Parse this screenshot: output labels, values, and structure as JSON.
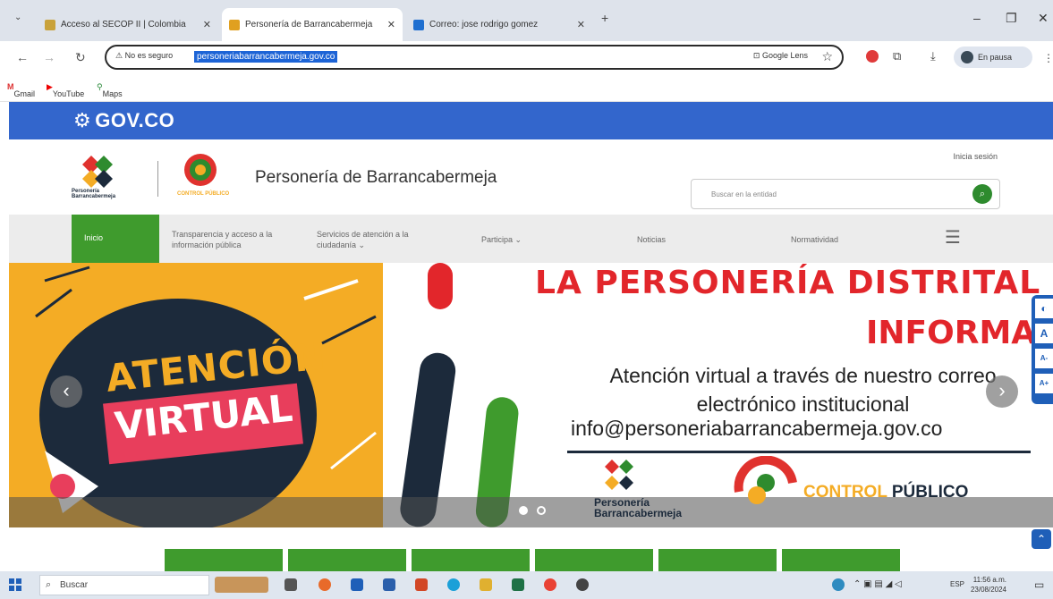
{
  "browser": {
    "tabs": [
      {
        "title": "Acceso al SECOP II | Colombia",
        "favicon_color": "#c9a23a"
      },
      {
        "title": "Personería de Barrancabermeja",
        "favicon_color": "#e0a020"
      },
      {
        "title": "Correo: jose rodrigo gomez",
        "favicon_color": "#1f6fd0"
      }
    ],
    "new_tab": "+",
    "address": {
      "security_label": "No es seguro",
      "url": "personeriabarrancabermeja.gov.co",
      "lens_label": "Google Lens"
    },
    "profile_label": "En pausa",
    "bookmarks": [
      "Gmail",
      "YouTube",
      "Maps"
    ]
  },
  "gov": {
    "logo": "GOV.CO"
  },
  "site": {
    "logo1_text": "Personería Barrancabermeja",
    "logo2_text": "CONTROL PÚBLICO",
    "title": "Personería de Barrancabermeja",
    "login": "Inicia sesión",
    "search_placeholder": "Buscar en la entidad",
    "menu": [
      {
        "label": "Inicio"
      },
      {
        "label": "Transparencia y acceso a la información pública"
      },
      {
        "label": "Servicios de atención a la ciudadanía ⌄"
      },
      {
        "label": "Participa ⌄"
      },
      {
        "label": "Noticias"
      },
      {
        "label": "Normatividad"
      }
    ]
  },
  "hero": {
    "badge_line1": "ATENCIÓN",
    "badge_line2": "VIRTUAL",
    "headline_line1": "LA PERSONERÍA DISTRITAL",
    "headline_line2": "INFORMA",
    "message": "Atención virtual a través de nuestro correo electrónico institucional",
    "email": "info@personeriabarrancabermeja.gov.co",
    "footer_logo_text": "Personería Barrancabermeja",
    "footer_cp_light": "CONTROL",
    "footer_cp_dark": "PÚBLICO",
    "carousel": {
      "slides": 2,
      "active": 1
    }
  },
  "a11y": [
    "◐",
    "A",
    "A-",
    "A+"
  ],
  "taskbar": {
    "search_label": "Buscar",
    "time": "11:56 a.m.",
    "date": "23/08/2024",
    "lang": "ESP"
  },
  "colors": {
    "gov_blue": "#3366cc",
    "menu_green": "#3f9b2d",
    "hero_orange": "#f4ac25",
    "hero_red": "#e2262b",
    "hero_navy": "#1c2a3b"
  }
}
